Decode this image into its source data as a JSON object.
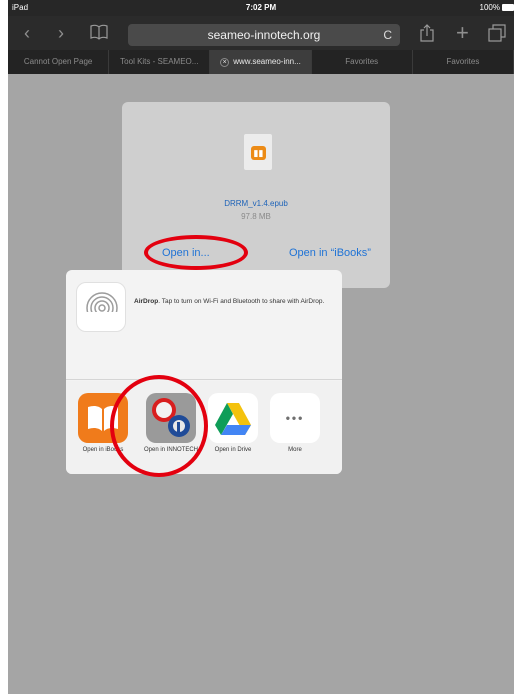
{
  "status_bar": {
    "device": "iPad",
    "time": "7:02 PM",
    "battery": "100%"
  },
  "toolbar": {
    "url": "seameo-innotech.org",
    "back_icon": "chevron-left-icon",
    "forward_icon": "chevron-right-icon",
    "bookmarks_icon": "book-icon",
    "reload_icon": "reload-icon",
    "share_icon": "share-icon",
    "new_tab_icon": "plus-icon",
    "tabs_icon": "tabs-icon"
  },
  "tabs": [
    {
      "label": "Cannot Open Page"
    },
    {
      "label": "Tool Kits - SEAMEO..."
    },
    {
      "label": "www.seameo-inn..."
    },
    {
      "label": "Favorites"
    },
    {
      "label": "Favorites"
    }
  ],
  "download": {
    "file_name": "DRRM_v1.4.epub",
    "file_size": "97.8 MB",
    "open_in_label": "Open in...",
    "open_in_ibooks_label": "Open in “iBooks”"
  },
  "share_sheet": {
    "airdrop_title": "AirDrop",
    "airdrop_text": ". Tap to turn on Wi-Fi and Bluetooth to share with AirDrop.",
    "apps": [
      {
        "label": "Open in iBooks",
        "icon": "ibooks-icon"
      },
      {
        "label": "Open in INNOTECH",
        "icon": "innotech-icon"
      },
      {
        "label": "Open in Drive",
        "icon": "drive-icon"
      },
      {
        "label": "More",
        "icon": "more-icon"
      }
    ]
  },
  "colors": {
    "highlight_ring": "#e3000f",
    "link_blue": "#1f73d6"
  }
}
